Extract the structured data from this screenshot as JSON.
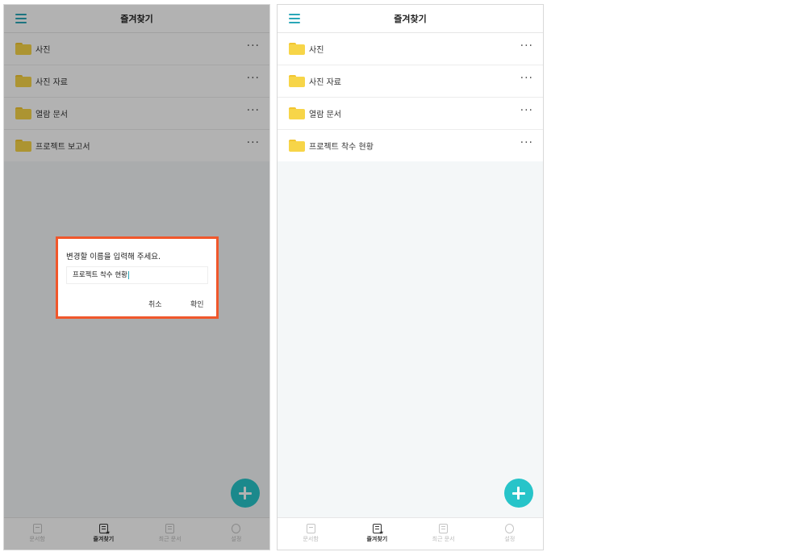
{
  "left_screen": {
    "header": {
      "title": "즐겨찾기"
    },
    "folders": [
      {
        "name": "사진",
        "more": "···"
      },
      {
        "name": "사진 자료",
        "more": "···"
      },
      {
        "name": "열람 문서",
        "more": "···"
      },
      {
        "name": "프로젝트 보고서",
        "more": "···"
      }
    ],
    "dialog": {
      "prompt": "변경할 이름을 입력해 주세요.",
      "input_value": "프로젝트 착수 현황",
      "cancel_label": "취소",
      "ok_label": "확인",
      "highlight_color": "#f0572b"
    },
    "bottom_nav": [
      {
        "label": "문서함",
        "icon": "document-box-icon",
        "active": false
      },
      {
        "label": "즐겨찾기",
        "icon": "favorite-document-icon",
        "active": true
      },
      {
        "label": "최근 문서",
        "icon": "recent-document-icon",
        "active": false
      },
      {
        "label": "설정",
        "icon": "gear-icon",
        "active": false
      }
    ]
  },
  "right_screen": {
    "header": {
      "title": "즐겨찾기"
    },
    "folders": [
      {
        "name": "사진",
        "more": "···"
      },
      {
        "name": "사진 자료",
        "more": "···"
      },
      {
        "name": "열람 문서",
        "more": "···"
      },
      {
        "name": "프로젝트 착수 현황",
        "more": "···"
      }
    ],
    "bottom_nav": [
      {
        "label": "문서함",
        "icon": "document-box-icon",
        "active": false
      },
      {
        "label": "즐겨찾기",
        "icon": "favorite-document-icon",
        "active": true
      },
      {
        "label": "최근 문서",
        "icon": "recent-document-icon",
        "active": false
      },
      {
        "label": "설정",
        "icon": "gear-icon",
        "active": false
      }
    ]
  },
  "colors": {
    "accent": "#27c4c9",
    "menu_icon": "#2aa7b8",
    "folder": "#f7d548",
    "overlay": "rgba(0,0,0,0.30)"
  }
}
